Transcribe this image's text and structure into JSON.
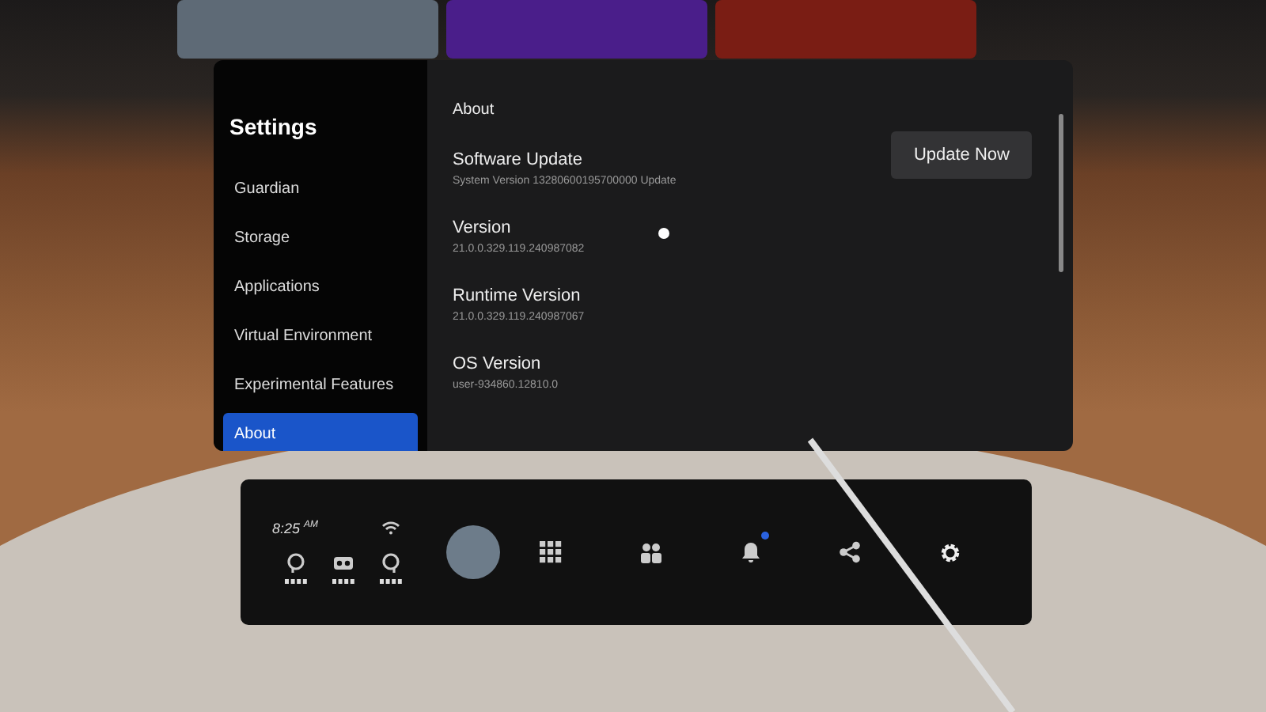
{
  "settings": {
    "title": "Settings",
    "sidebar": [
      {
        "label": "Guardian",
        "selected": false
      },
      {
        "label": "Storage",
        "selected": false
      },
      {
        "label": "Applications",
        "selected": false
      },
      {
        "label": "Virtual Environment",
        "selected": false
      },
      {
        "label": "Experimental Features",
        "selected": false
      },
      {
        "label": "About",
        "selected": true
      }
    ],
    "section_title": "About",
    "rows": [
      {
        "label": "Software Update",
        "value": "System Version 13280600195700000 Update",
        "button": "Update Now"
      },
      {
        "label": "Version",
        "value": "21.0.0.329.119.240987082"
      },
      {
        "label": "Runtime Version",
        "value": "21.0.0.329.119.240987067"
      },
      {
        "label": "OS Version",
        "value": "user-934860.12810.0"
      }
    ]
  },
  "taskbar": {
    "time": "8:25 $^{AM}$",
    "notification_badge": true
  }
}
